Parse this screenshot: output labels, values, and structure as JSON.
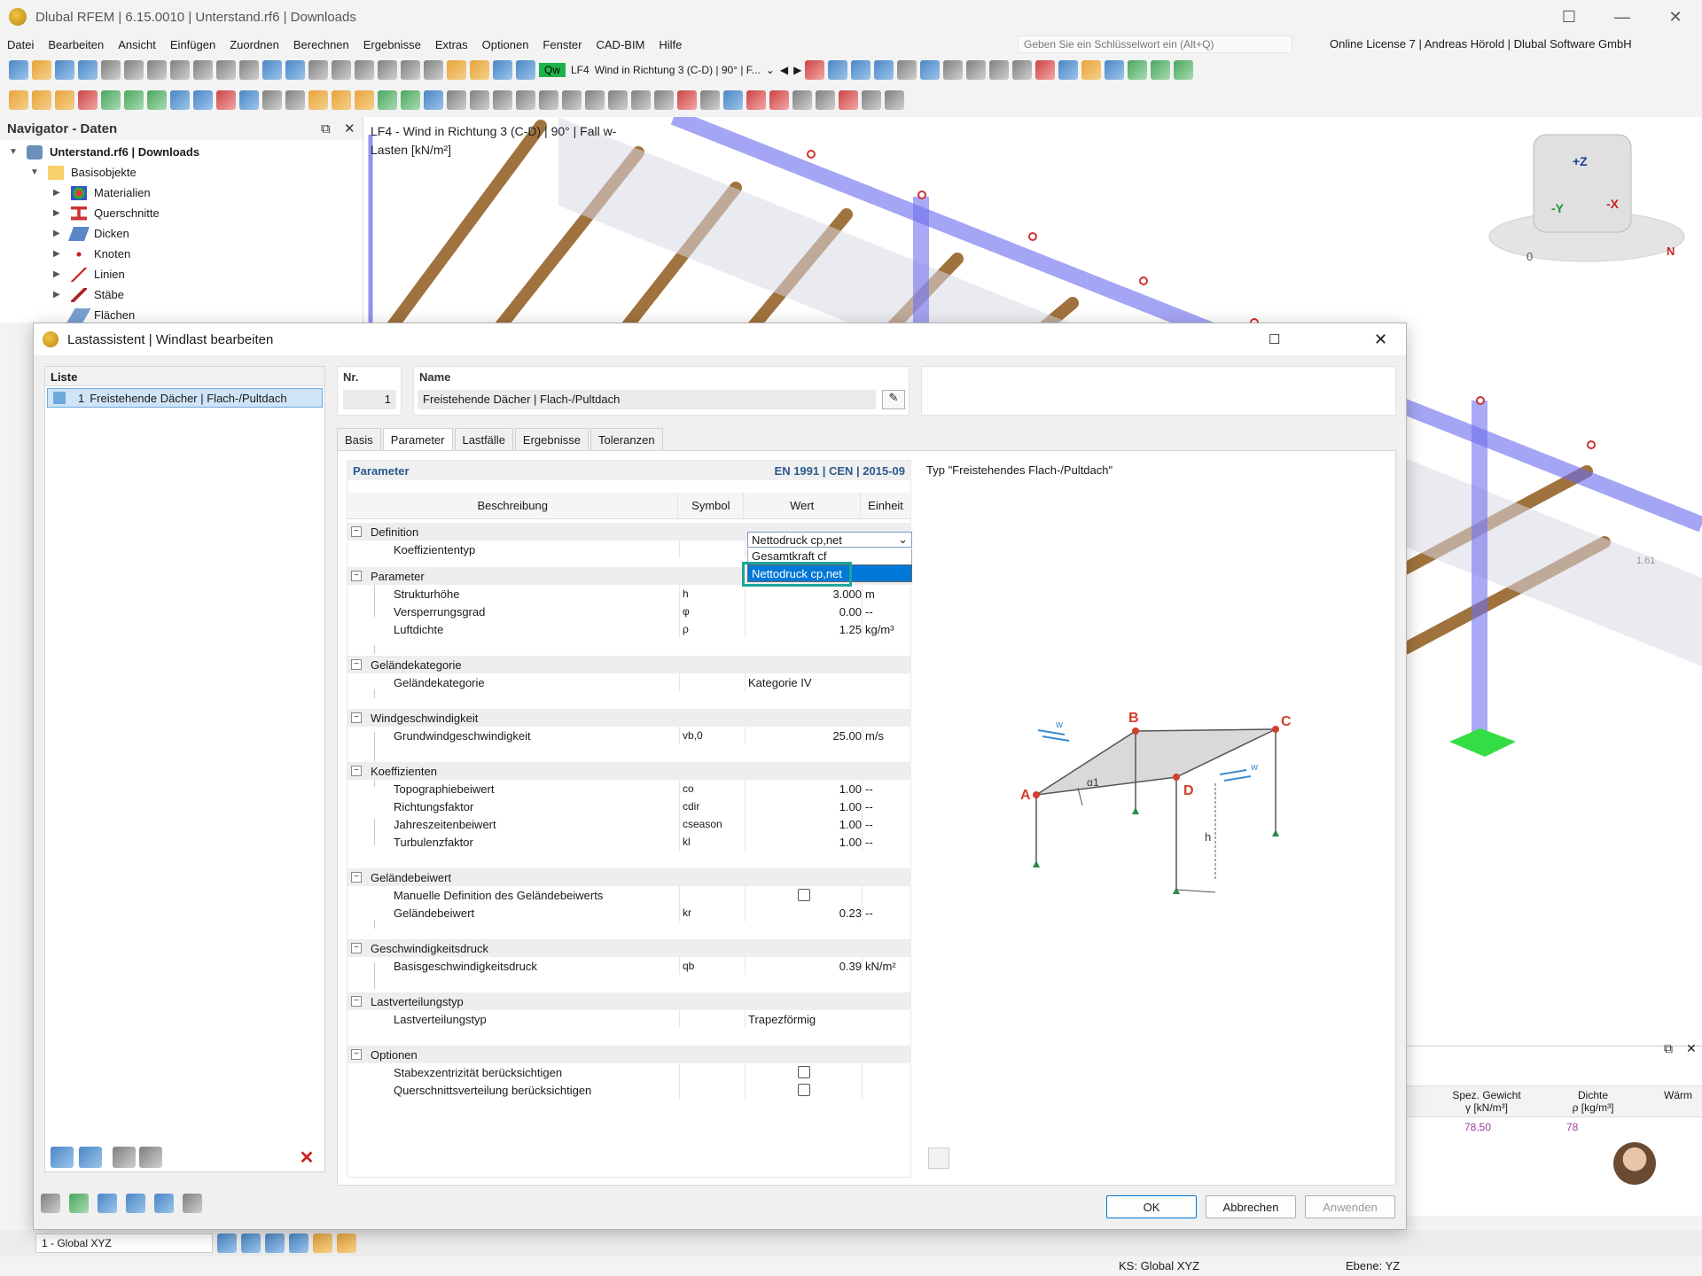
{
  "app": {
    "title": "Dlubal RFEM | 6.15.0010 | Unterstand.rf6 | Downloads",
    "window_controls": [
      "—",
      "☐",
      "✕"
    ]
  },
  "menu": [
    "Datei",
    "Bearbeiten",
    "Ansicht",
    "Einfügen",
    "Zuordnen",
    "Berechnen",
    "Ergebnisse",
    "Extras",
    "Optionen",
    "Fenster",
    "CAD-BIM",
    "Hilfe"
  ],
  "search": {
    "placeholder": "Geben Sie ein Schlüsselwort ein (Alt+Q)"
  },
  "license": "Online License 7 | Andreas Hörold | Dlubal Software GmbH",
  "toolbar": {
    "qw_label": "Qw",
    "loadcase": "LF4",
    "loadcase_desc": "Wind in Richtung 3 (C-D) | 90° | F..."
  },
  "navigator": {
    "title": "Navigator - Daten",
    "root": "Unterstand.rf6 | Downloads",
    "items": [
      {
        "label": "Basisobjekte",
        "level": 1
      },
      {
        "label": "Materialien",
        "level": 2
      },
      {
        "label": "Querschnitte",
        "level": 2
      },
      {
        "label": "Dicken",
        "level": 2
      },
      {
        "label": "Knoten",
        "level": 2
      },
      {
        "label": "Linien",
        "level": 2
      },
      {
        "label": "Stäbe",
        "level": 2
      },
      {
        "label": "Flächen",
        "level": 2
      }
    ]
  },
  "viewport": {
    "title_line1": "LF4 - Wind in Richtung 3 (C-D) | 90° | Fall w-",
    "title_line2": "Lasten [kN/m²]",
    "value_label": "1.61",
    "cube_axes": [
      "+Z",
      "-Y",
      "-X"
    ],
    "compass_n": "N",
    "compass_0": "0"
  },
  "right_table": {
    "col1": "Spez. Gewicht",
    "col1_unit": "γ [kN/m³]",
    "col2": "Dichte",
    "col2_unit": "ρ [kg/m³]",
    "col3": "Wärm",
    "row_val1": "78.50",
    "row_val2": "78"
  },
  "bottombar": {
    "coord_system": "1 - Global XYZ"
  },
  "statusbar": {
    "ks": "KS: Global XYZ",
    "ebene": "Ebene: YZ"
  },
  "dialog": {
    "title": "Lastassistent | Windlast bearbeiten",
    "list_header": "Liste",
    "list_items": [
      {
        "nr": "1",
        "label": "Freistehende Dächer | Flach-/Pultdach"
      }
    ],
    "nr_label": "Nr.",
    "nr_value": "1",
    "name_label": "Name",
    "name_value": "Freistehende Dächer | Flach-/Pultdach",
    "tabs": [
      "Basis",
      "Parameter",
      "Lastfälle",
      "Ergebnisse",
      "Toleranzen"
    ],
    "active_tab": "Parameter",
    "param_header": "Parameter",
    "norm": "EN 1991 | CEN | 2015-09",
    "columns": {
      "desc": "Beschreibung",
      "symbol": "Symbol",
      "value": "Wert",
      "unit": "Einheit"
    },
    "groups": {
      "definition": "Definition",
      "parameter": "Parameter",
      "gelaendekategorie": "Geländekategorie",
      "windgeschw": "Windgeschwindigkeit",
      "koeffizienten": "Koeffizienten",
      "gelaendebeiwert": "Geländebeiwert",
      "geschwdruck": "Geschwindigkeitsdruck",
      "lastverteilung": "Lastverteilungstyp",
      "optionen": "Optionen"
    },
    "rows": {
      "koeff_typ": {
        "desc": "Koeffiziententyp",
        "value": "Nettodruck cp,net"
      },
      "h": {
        "desc": "Strukturhöhe",
        "sym": "h",
        "value": "3.000",
        "unit": "m"
      },
      "phi": {
        "desc": "Versperrungsgrad",
        "sym": "φ",
        "value": "0.00",
        "unit": "--"
      },
      "rho": {
        "desc": "Luftdichte",
        "sym": "ρ",
        "value": "1.25",
        "unit": "kg/m³"
      },
      "kat": {
        "desc": "Geländekategorie",
        "value": "Kategorie IV"
      },
      "vb0": {
        "desc": "Grundwindgeschwindigkeit",
        "sym": "vb,0",
        "value": "25.00",
        "unit": "m/s"
      },
      "co": {
        "desc": "Topographiebeiwert",
        "sym": "co",
        "value": "1.00",
        "unit": "--"
      },
      "cdir": {
        "desc": "Richtungsfaktor",
        "sym": "cdir",
        "value": "1.00",
        "unit": "--"
      },
      "cseason": {
        "desc": "Jahreszeitenbeiwert",
        "sym": "cseason",
        "value": "1.00",
        "unit": "--"
      },
      "kl": {
        "desc": "Turbulenzfaktor",
        "sym": "kl",
        "value": "1.00",
        "unit": "--"
      },
      "manual": {
        "desc": "Manuelle Definition des Geländebeiwerts"
      },
      "kr": {
        "desc": "Geländebeiwert",
        "sym": "kr",
        "value": "0.23",
        "unit": "--"
      },
      "qb": {
        "desc": "Basisgeschwindigkeitsdruck",
        "sym": "qb",
        "value": "0.39",
        "unit": "kN/m²"
      },
      "lvt": {
        "desc": "Lastverteilungstyp",
        "value": "Trapezförmig"
      },
      "exz": {
        "desc": "Stabexzentrizität berücksichtigen"
      },
      "qsv": {
        "desc": "Querschnittsverteilung berücksichtigen"
      }
    },
    "dropdown": {
      "selected": "Nettodruck cp,net",
      "options": [
        "Gesamtkraft cf",
        "Nettodruck cp,net"
      ]
    },
    "preview_title": "Typ \"Freistehendes Flach-/Pultdach\"",
    "diagram_labels": {
      "A": "A",
      "B": "B",
      "C": "C",
      "D": "D",
      "h": "h",
      "alpha": "α1",
      "w": "w"
    },
    "buttons": {
      "ok": "OK",
      "cancel": "Abbrechen",
      "apply": "Anwenden"
    }
  }
}
